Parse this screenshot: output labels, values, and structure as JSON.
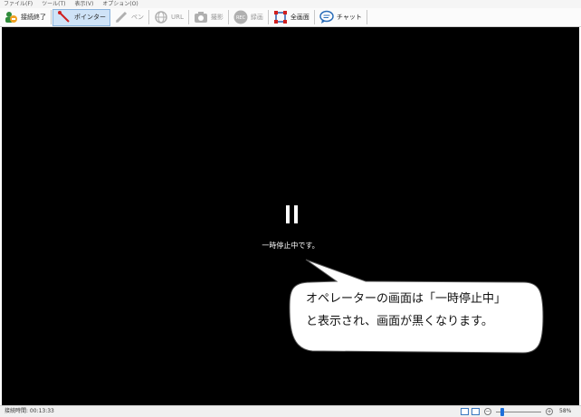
{
  "menu": [
    "ファイル(F)",
    "ツール(T)",
    "表示(V)",
    "オプション(O)"
  ],
  "toolbar": {
    "disconnect": "接続終了",
    "pointer": "ポインター",
    "pen": "ペン",
    "url": "URL",
    "capture": "撮影",
    "record": "録画",
    "fullscreen": "全画面",
    "chat": "チャット",
    "rec_badge": "REC"
  },
  "viewer": {
    "pause_message": "一時停止中です。"
  },
  "callout": {
    "line1": "オペレーターの画面は「一時停止中」",
    "line2": "と表示され、画面が黒くなります。"
  },
  "status": {
    "connection_time": "接続時間: 00:13:33",
    "zoom": "58%",
    "zoom_level": 58
  },
  "colors": {
    "accent": "#1e6fd9",
    "active_tool_bg": "#cfe3f7",
    "viewer_bg": "#000000"
  }
}
